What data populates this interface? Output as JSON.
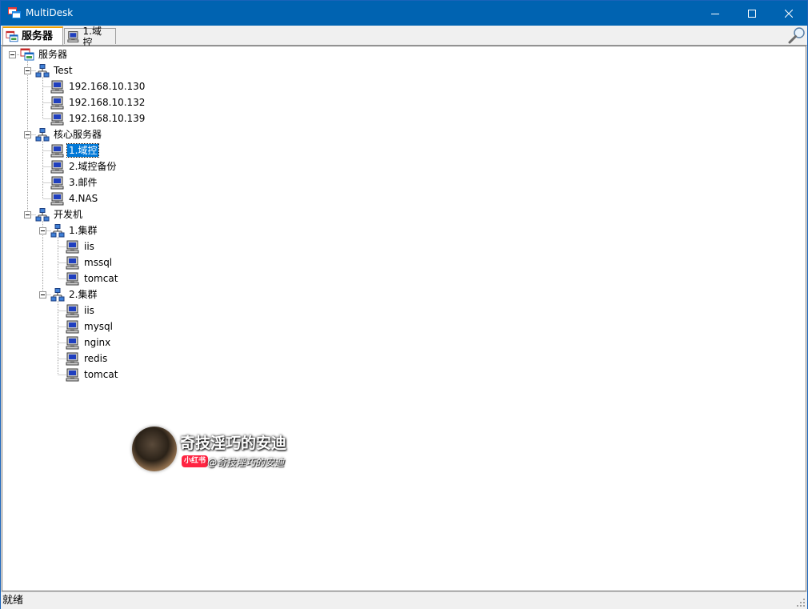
{
  "window": {
    "title": "MultiDesk"
  },
  "tabs": [
    {
      "label": "服务器",
      "icon": "server-group-icon",
      "active": true
    },
    {
      "label": "1.域控",
      "icon": "computer-icon",
      "active": false
    }
  ],
  "tree": {
    "root": {
      "label": "服务器",
      "icon": "server-group-icon"
    },
    "groups": [
      {
        "label": "Test",
        "icon": "network-icon",
        "items": [
          "192.168.10.130",
          "192.168.10.132",
          "192.168.10.139"
        ]
      },
      {
        "label": "核心服务器",
        "icon": "network-icon",
        "items": [
          "1.域控",
          "2.域控备份",
          "3.邮件",
          "4.NAS"
        ]
      },
      {
        "label": "开发机",
        "icon": "network-icon",
        "subgroups": [
          {
            "label": "1.集群",
            "items": [
              "iis",
              "mssql",
              "tomcat"
            ]
          },
          {
            "label": "2.集群",
            "items": [
              "iis",
              "mysql",
              "nginx",
              "redis",
              "tomcat"
            ]
          }
        ]
      }
    ],
    "selected": "1.域控"
  },
  "watermark": {
    "title": "奇技淫巧的安迪",
    "badge": "小红书",
    "handle": "@奇技淫巧的安迪"
  },
  "status": {
    "text": "就绪"
  },
  "colors": {
    "titlebar": "#0063b1",
    "selection": "#0078d7",
    "tab_accent": "#f0a000"
  }
}
